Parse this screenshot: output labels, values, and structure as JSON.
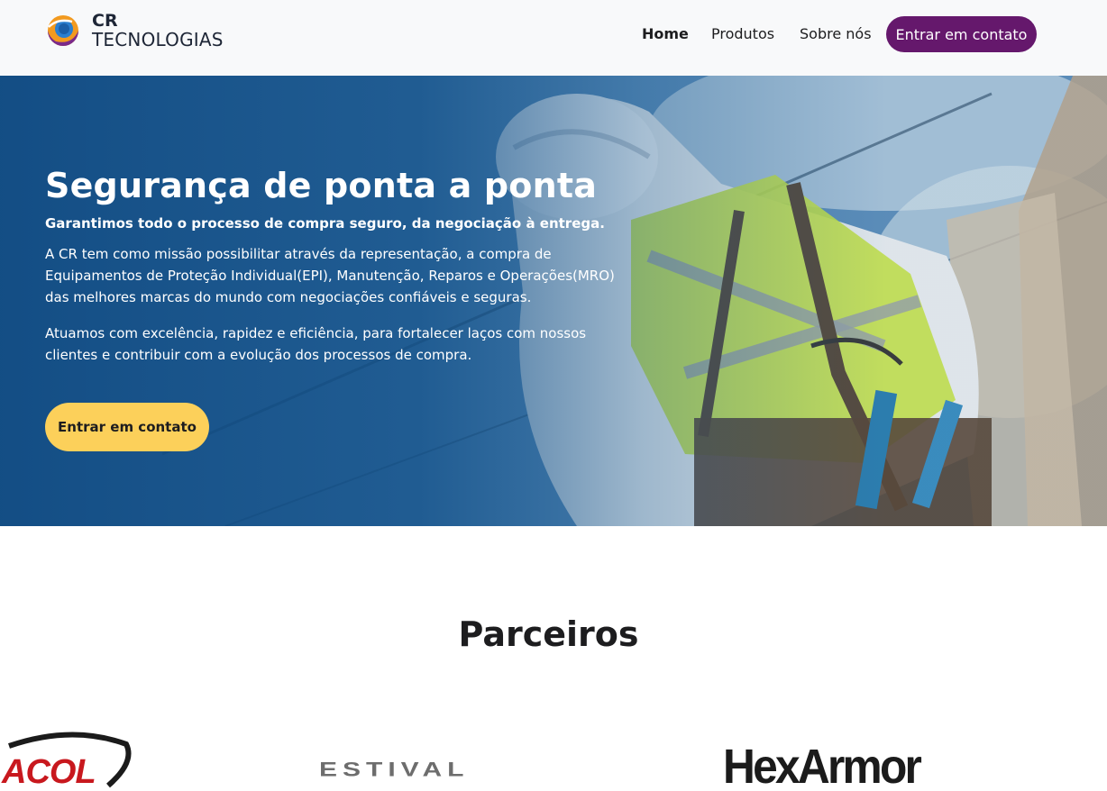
{
  "colors": {
    "header_bg": "#f8f9fa",
    "nav_cta_bg": "#65186c",
    "hero_bg": "#0f4f86",
    "hero_cta_bg": "#fcd05a",
    "text_dark": "#1d1d1f"
  },
  "header": {
    "logo": {
      "icon": "cr-logo-icon",
      "line1": "CR",
      "line2": "TECNOLOGIAS"
    },
    "nav": {
      "items": [
        {
          "label": "Home",
          "active": true
        },
        {
          "label": "Produtos",
          "active": false
        },
        {
          "label": "Sobre nós",
          "active": false
        }
      ],
      "cta_label": "Entrar em contato"
    }
  },
  "hero": {
    "title": "Segurança de ponta a ponta",
    "subtitle": "Garantimos todo o processo de compra seguro, da negociação à entrega.",
    "paragraphs": [
      "A CR tem como missão possibilitar através da representação, a compra de Equipamentos de Proteção Individual(EPI), Manutenção, Reparos e Operações(MRO) das melhores marcas do mundo com negociações confiáveis e seguras.",
      "Atuamos com excelência, rapidez e eficiência, para fortalecer laços com nossos clientes e contribuir com a evolução dos processos de compra."
    ],
    "cta_label": "Entrar em contato"
  },
  "partners": {
    "title": "Parceiros",
    "logos": [
      {
        "name": "ACOL"
      },
      {
        "name": "ESTIVAL"
      },
      {
        "name": "HexArmor"
      }
    ]
  }
}
